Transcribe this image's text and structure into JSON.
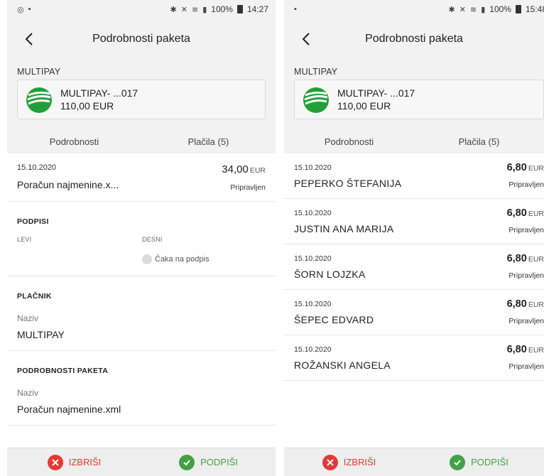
{
  "colors": {
    "accent": "#2e7ab8",
    "delete": "#e53935",
    "sign": "#43a047",
    "logo": "#21a038"
  },
  "left": {
    "status_bar": {
      "time": "14:27",
      "battery": "100%",
      "left_icons": [
        "whatsapp-icon",
        "sd-card-icon"
      ]
    },
    "header": {
      "title": "Podrobnosti paketa"
    },
    "account": {
      "label": "MULTIPAY",
      "name": "MULTIPAY- ...017",
      "amount": "110,00 EUR"
    },
    "tabs": [
      {
        "label": "Podrobnosti",
        "active": true
      },
      {
        "label": "Plačila (5)",
        "active": false
      }
    ],
    "summary": {
      "date": "15.10.2020",
      "amount": "34,00",
      "currency": "EUR",
      "name": "Poračun najmenine.x...",
      "status": "Pripravljen"
    },
    "signatures": {
      "title": "PODPISI",
      "left_label": "LEVI",
      "right_label": "DESNI",
      "status": "Čaka na podpis"
    },
    "payer": {
      "title": "PLAČNIK",
      "field_label": "Naziv",
      "field_value": "MULTIPAY"
    },
    "package": {
      "title": "PODROBNOSTI PAKETA",
      "field_label": "Naziv",
      "field_value": "Poračun najmenine.xml"
    },
    "bottom": {
      "delete_label": "IZBRIŠI",
      "sign_label": "PODPIŠI"
    }
  },
  "right": {
    "status_bar": {
      "time": "15:48",
      "battery": "100%",
      "left_icons": [
        "sd-card-icon"
      ]
    },
    "header": {
      "title": "Podrobnosti paketa"
    },
    "account": {
      "label": "MULTIPAY",
      "name": "MULTIPAY- ...017",
      "amount": "110,00 EUR"
    },
    "tabs": [
      {
        "label": "Podrobnosti",
        "active": false
      },
      {
        "label": "Plačila (5)",
        "active": true
      }
    ],
    "payments": [
      {
        "date": "15.10.2020",
        "name": "PEPERKO ŠTEFANIJA",
        "amount": "6,80",
        "currency": "EUR",
        "status": "Pripravljen"
      },
      {
        "date": "15.10.2020",
        "name": "JUSTIN ANA MARIJA",
        "amount": "6,80",
        "currency": "EUR",
        "status": "Pripravljen"
      },
      {
        "date": "15.10.2020",
        "name": "ŠORN LOJZKA",
        "amount": "6,80",
        "currency": "EUR",
        "status": "Pripravljen"
      },
      {
        "date": "15.10.2020",
        "name": "ŠEPEC EDVARD",
        "amount": "6,80",
        "currency": "EUR",
        "status": "Pripravljen"
      },
      {
        "date": "15.10.2020",
        "name": "ROŽANSKI ANGELA",
        "amount": "6,80",
        "currency": "EUR",
        "status": "Pripravljen"
      }
    ],
    "bottom": {
      "delete_label": "IZBRIŠI",
      "sign_label": "PODPIŠI"
    }
  }
}
